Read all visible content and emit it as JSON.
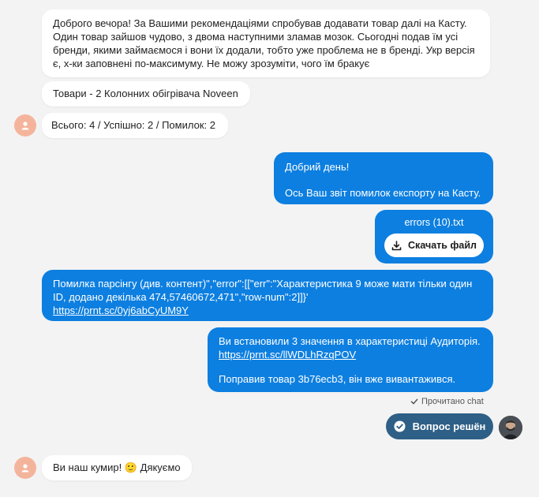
{
  "messages": {
    "m1": "Доброго вечора! За Вашими рекомендаціями спробував додавати товар далі на Касту. Один товар зайшов чудово, з двома наступними зламав мозок. Сьогодні подав їм усі бренди, якими займаємося і вони їх додали, тобто уже проблема не в бренді. Укр версія є, х-ки заповнені по-максимуму. Не можу зрозуміти, чого їм бракує",
    "m2": "Товари - 2 Колонних обігрівача Noveen",
    "m3": "Всього: 4 / Успішно: 2 / Помилок: 2",
    "m4_line1": "Добрий день!",
    "m4_line2": "Ось Ваш звіт помилок експорту на Касту.",
    "file_name": "errors (10).txt",
    "download_label": "Скачать файл",
    "m6_text": "Помилка парсінгу (див. контент)\",\"error\":[[\"err\":\"Характеристика 9 може мати тільки один ID, додано декілька 474,57460672,471\",\"row-num\":2]]}'",
    "m6_link": "https://prnt.sc/0yj6abCyUM9Y",
    "m7_text": "Ви встановили 3 значення в характеристиці Аудиторія.",
    "m7_link": "https://prnt.sc/llWDLhRzqPOV",
    "m7_text2": "Поправив товар 3b76ecb3, він вже вивантажився.",
    "read_status": "Прочитано chat",
    "resolved_label": "Вопрос решён",
    "m8": "Ви наш кумир! 🙂 Дякуємо"
  },
  "icons": {
    "user_avatar": "person-icon",
    "download": "download-icon",
    "check": "check-icon",
    "resolved": "check-circle-icon"
  },
  "colors": {
    "background": "#f3f3f3",
    "incoming_bubble": "#ffffff",
    "outgoing_bubble": "#0d7fe0",
    "resolved_button": "#2e5f86",
    "user_avatar": "#f4b49c"
  }
}
